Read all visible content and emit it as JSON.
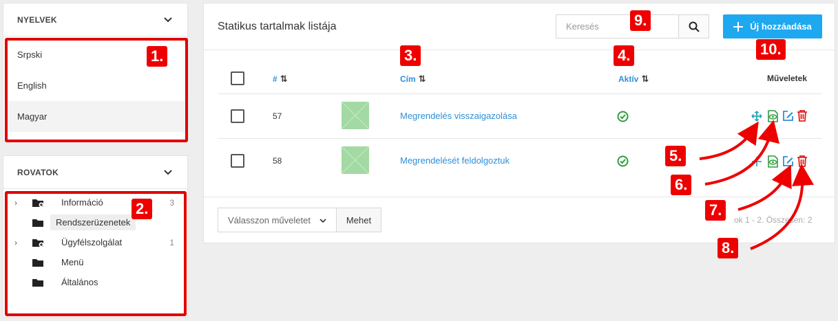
{
  "languages": {
    "title": "NYELVEK",
    "items": [
      {
        "label": "Srpski"
      },
      {
        "label": "English"
      },
      {
        "label": "Magyar"
      }
    ]
  },
  "sections": {
    "title": "ROVATOK",
    "items": [
      {
        "label": "Információ",
        "count": "3",
        "expandable": true
      },
      {
        "label": "Rendszerüzenetek",
        "count": "",
        "expandable": false
      },
      {
        "label": "Ügyfélszolgálat",
        "count": "1",
        "expandable": true
      },
      {
        "label": "Menü",
        "count": "",
        "expandable": false
      },
      {
        "label": "Általános",
        "count": "",
        "expandable": false
      }
    ]
  },
  "main": {
    "title": "Statikus tartalmak listája",
    "search_placeholder": "Keresés",
    "add_label": "Új hozzáadása",
    "columns": {
      "id": "#",
      "title": "Cím",
      "active": "Aktív",
      "actions": "Műveletek"
    },
    "rows": [
      {
        "id": "57",
        "title": "Megrendelés visszaigazolása",
        "active": true
      },
      {
        "id": "58",
        "title": "Megrendelését feldolgoztuk",
        "active": true
      }
    ],
    "bulk_select": "Válasszon műveletet",
    "go_label": "Mehet",
    "pagination": "ok 1 - 2. Összesen: 2"
  },
  "annotations": [
    "1.",
    "2.",
    "3.",
    "4.",
    "5.",
    "6.",
    "7.",
    "8.",
    "9.",
    "10."
  ],
  "colors": {
    "accent": "#1ea8f0",
    "link": "#2d8fd7",
    "annotation": "#ee0000",
    "success": "#2e9c3c",
    "danger": "#e02020"
  }
}
